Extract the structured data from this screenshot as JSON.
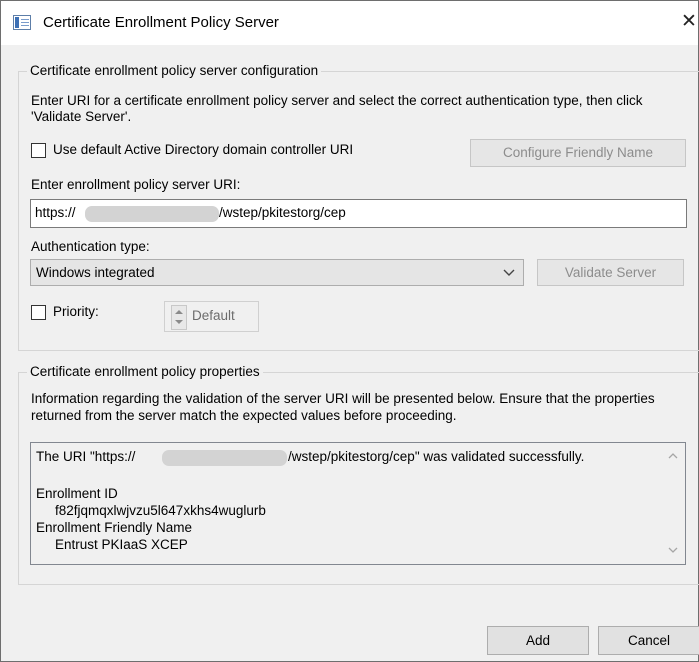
{
  "window": {
    "title": "Certificate Enrollment Policy Server",
    "close_glyph": "✕",
    "icon": "certificate-window-icon"
  },
  "config_group": {
    "legend": "Certificate enrollment policy server configuration",
    "instructions": "Enter URI for a certificate enrollment policy server and select the correct authentication type, then click 'Validate Server'.",
    "use_default_label": "Use default Active Directory domain controller URI",
    "use_default_checked": false,
    "configure_friendly_name_label": "Configure Friendly Name",
    "uri_label": "Enter enrollment policy server URI:",
    "uri_prefix": "https://",
    "uri_suffix": "/wstep/pkitestorg/cep",
    "auth_label": "Authentication type:",
    "auth_value": "Windows integrated",
    "validate_label": "Validate Server",
    "priority_label": "Priority:",
    "priority_checked": false,
    "priority_value": "Default"
  },
  "props_group": {
    "legend": "Certificate enrollment policy properties",
    "info": "Information regarding the validation of the server URI will be presented below. Ensure that the properties returned from the server match the expected values before proceeding.",
    "result_prefix": "The URI \"https://",
    "result_suffix": "/wstep/pkitestorg/cep\" was validated successfully.",
    "enrollment_id_label": "Enrollment ID",
    "enrollment_id_value": "f82fjqmqxlwjvzu5l647xkhs4wuglurb",
    "friendly_name_label": "Enrollment Friendly Name",
    "friendly_name_value": "Entrust PKIaaS XCEP"
  },
  "footer": {
    "add_label": "Add",
    "cancel_label": "Cancel"
  },
  "colors": {
    "window_bg": "#f0f0f0",
    "disabled_text": "#8c8c8c",
    "redaction": "#d3d3d3"
  }
}
